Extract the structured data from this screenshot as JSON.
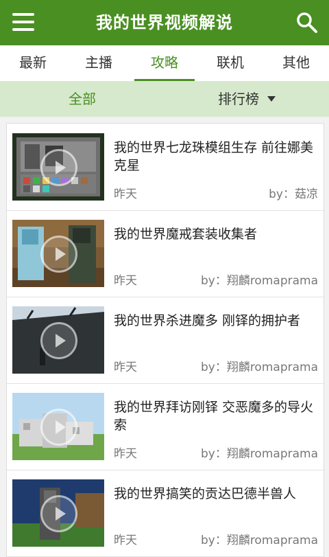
{
  "header": {
    "title": "我的世界视频解说",
    "menu_icon": "menu-icon",
    "search_icon": "search-icon",
    "color": "#4a8f22"
  },
  "tabs": [
    {
      "label": "最新",
      "active": false
    },
    {
      "label": "主播",
      "active": false
    },
    {
      "label": "攻略",
      "active": true
    },
    {
      "label": "联机",
      "active": false
    },
    {
      "label": "其他",
      "active": false
    }
  ],
  "filters": {
    "all": "全部",
    "rank": "排行榜"
  },
  "videos": [
    {
      "title": "我的世界七龙珠模组生存 前往娜美克星",
      "date": "昨天",
      "author": "by：菇凉"
    },
    {
      "title": "我的世界魔戒套装收集者",
      "date": "昨天",
      "author": "by：翔麟romaprama"
    },
    {
      "title": "我的世界杀进魔多 刚铎的拥护者",
      "date": "昨天",
      "author": "by：翔麟romaprama"
    },
    {
      "title": "我的世界拜访刚铎 交恶魔多的导火索",
      "date": "昨天",
      "author": "by：翔麟romaprama"
    },
    {
      "title": "我的世界搞笑的贡达巴德半兽人",
      "date": "昨天",
      "author": "by：翔麟romaprama"
    }
  ]
}
